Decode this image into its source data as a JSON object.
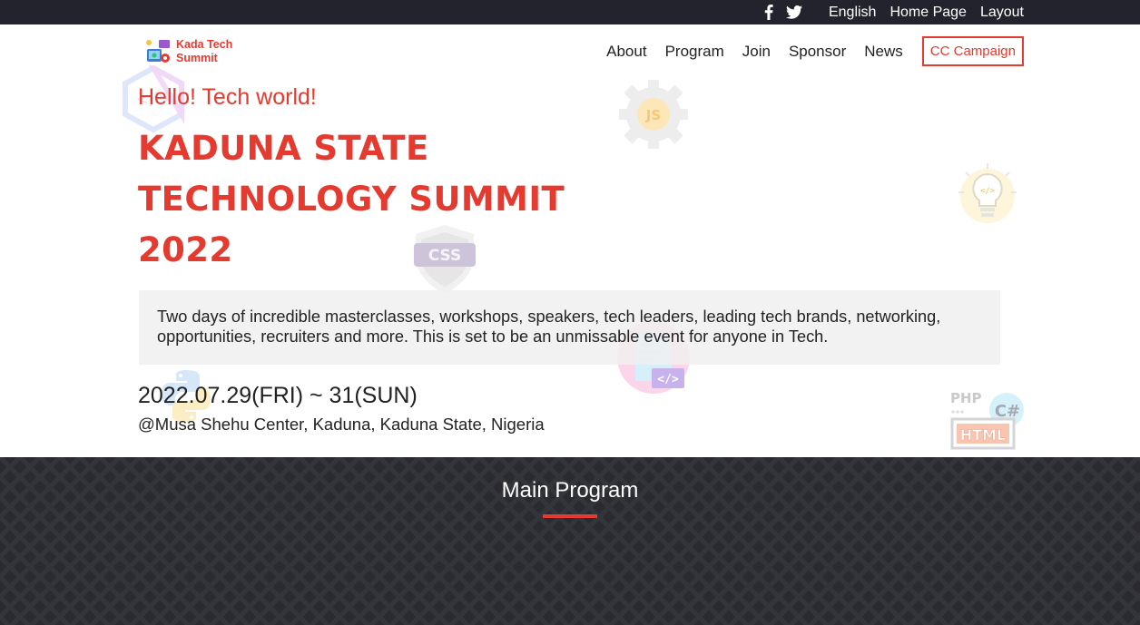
{
  "topbar": {
    "social": [
      {
        "icon": "facebook-icon"
      },
      {
        "icon": "twitter-icon"
      }
    ],
    "links": [
      "English",
      "Home Page",
      "Layout"
    ]
  },
  "header": {
    "logo_text_line1": "Kada Tech",
    "logo_text_line2": "Summit",
    "nav": [
      "About",
      "Program",
      "Join",
      "Sponsor",
      "News"
    ],
    "cta": "CC Campaign"
  },
  "hero": {
    "greeting": "Hello! Tech world!",
    "title_lines": [
      "KADUNA STATE",
      "TECHNOLOGY SUMMIT",
      "2022"
    ],
    "description": "Two days of incredible masterclasses, workshops, speakers, tech leaders, leading tech brands, networking, opportunities, recruiters and more. This is set to be an unmissable event for anyone in Tech.",
    "date": "2022.07.29(FRI) ~ 31(SUN)",
    "venue": "@Musa Shehu Center, Kaduna, Kaduna State, Nigeria"
  },
  "decor_labels": {
    "js": "JS",
    "css": "CSS",
    "php": "PHP",
    "csharp": "C#",
    "html": "HTML"
  },
  "program": {
    "title": "Main Program"
  },
  "colors": {
    "accent": "#e53a2f",
    "topbar_bg": "#23232d",
    "section_bg": "#2a2a30"
  }
}
